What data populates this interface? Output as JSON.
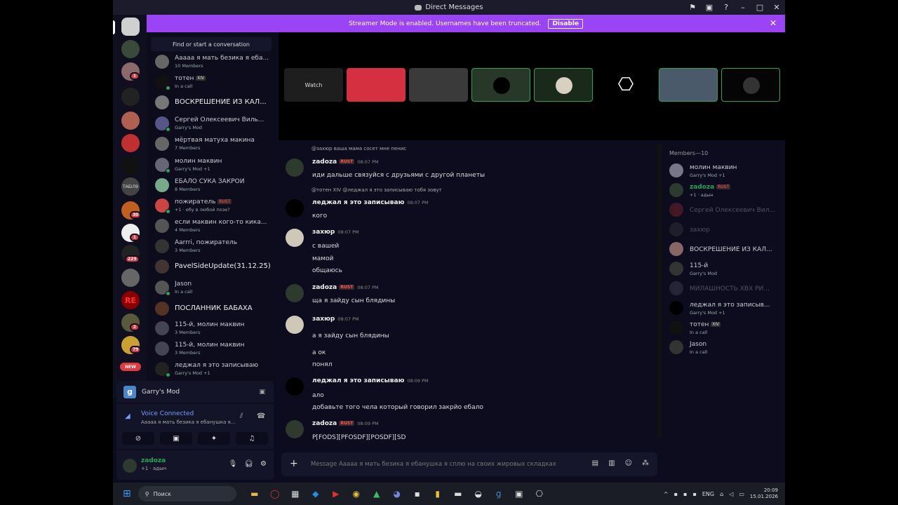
{
  "window": {
    "title": "Direct Messages"
  },
  "banner": {
    "text": "Streamer Mode is enabled. Usernames have been truncated.",
    "button": "Disable"
  },
  "rail": {
    "badges": [
      "1",
      "30",
      "1",
      "229",
      "2",
      "79"
    ],
    "server_labels": [
      "ТАБІЛ9",
      "RE"
    ],
    "new_label": "NEW"
  },
  "dm": {
    "search": "Find or start a conversation",
    "items": [
      {
        "name": "Ааааа я мать безика я еба...",
        "sub": "10 Members"
      },
      {
        "name": "тотен",
        "tag": "XIV",
        "sub": "In a call"
      },
      {
        "name": "ВОСКРЕШЕНИЕ ИЗ КАЛ...",
        "sub": ""
      },
      {
        "name": "Сергей Олексеевич Виль...",
        "sub": "Garry's Mod"
      },
      {
        "name": "мёртвая матуха макина",
        "sub": "7 Members"
      },
      {
        "name": "молин маквин",
        "sub": "Garry's Mod +1"
      },
      {
        "name": "ЕБАЛО СУКА ЗАКРОЙ",
        "sub": "8 Members"
      },
      {
        "name": "пожиратель",
        "tag": "RUST",
        "sub": "+1 · ебу в любой позе?"
      },
      {
        "name": "если маквин кого-то кика...",
        "sub": "4 Members"
      },
      {
        "name": "Aarrri, пожиратель",
        "sub": "3 Members"
      },
      {
        "name": "PavelSideUpdate(31.12.25)",
        "sub": ""
      },
      {
        "name": "Jason",
        "sub": "In a call"
      },
      {
        "name": "ПОСЛАННИК БАБАХА",
        "sub": ""
      },
      {
        "name": "115-й, молин маквин",
        "sub": "3 Members"
      },
      {
        "name": "115-й, молин маквин",
        "sub": "3 Members"
      },
      {
        "name": "леджал я это записываю",
        "sub": "Garry's Mod +1"
      }
    ]
  },
  "activity": {
    "game": "Garry's Mod"
  },
  "voice": {
    "status": "Voice Connected",
    "channel": "Ааааа я мать безика я ебанушка я..."
  },
  "user": {
    "name": "zadoza",
    "status": "+1 · адын"
  },
  "stage": {
    "watch": "Watch"
  },
  "chat": {
    "messages": [
      {
        "reply": "@захюр ваша мама сосет мне пенис",
        "name": "zadoza",
        "tag": "RUST",
        "time": "08:07 PM",
        "lines": [
          "иди дальше связуйся с друзьями с другой планеты"
        ]
      },
      {
        "reply": "@тотен  XIV  @леджал я это записываю тобя зовут",
        "name": "леджал я это записываю",
        "time": "08:07 PM",
        "lines": [
          "кого"
        ]
      },
      {
        "name": "захюр",
        "time": "08:07 PM",
        "lines": [
          "с вашей",
          "мамой",
          "общаюсь"
        ]
      },
      {
        "name": "zadoza",
        "tag": "RUST",
        "time": "08:07 PM",
        "lines": [
          "ща я зайду сын блядины"
        ]
      },
      {
        "name": "захюр",
        "time": "08:07 PM",
        "lines": [
          "а я зайду сын блядины",
          "а ок",
          "понял"
        ]
      },
      {
        "name": "леджал я это записываю",
        "time": "08:09 PM",
        "lines": [
          "ало",
          "добавьте того чела который говорил закрйо ебало"
        ]
      },
      {
        "name": "zadoza",
        "tag": "RUST",
        "time": "08:09 PM",
        "lines": [
          "P[FODS][PFOSDF][POSDF][SD"
        ]
      }
    ]
  },
  "input": {
    "placeholder": "Message Ааааа я мать безика я ебанушка я сплю на своих жировых складках"
  },
  "members": {
    "header": "Members—10",
    "list": [
      {
        "name": "молин маквин",
        "sub": "Garry's Mod +1"
      },
      {
        "name": "zadoza",
        "tag": "RUST",
        "sub": "+1 · адын"
      },
      {
        "name": "Сергей Олексеевич Вил...",
        "sub": ""
      },
      {
        "name": "захюр",
        "sub": ""
      },
      {
        "name": "ВОСКРЕШЕНИЕ ИЗ КАЛ...",
        "sub": ""
      },
      {
        "name": "115-й",
        "sub": "Garry's Mod"
      },
      {
        "name": "МИЛАШНОСТЬ XBX РИ...",
        "sub": ""
      },
      {
        "name": "леджал я это записыв...",
        "sub": "Garry's Mod +1"
      },
      {
        "name": "тотен",
        "tag": "XIV",
        "sub": "In a call"
      },
      {
        "name": "Jason",
        "sub": "In a call"
      }
    ]
  },
  "taskbar": {
    "search": "Поиск",
    "lang": "ENG",
    "time": "20:09",
    "date": "15.01.2026"
  },
  "colors": {
    "accent": "#9b44f5",
    "online": "#23a55a",
    "bg": "#0c0c1e"
  }
}
